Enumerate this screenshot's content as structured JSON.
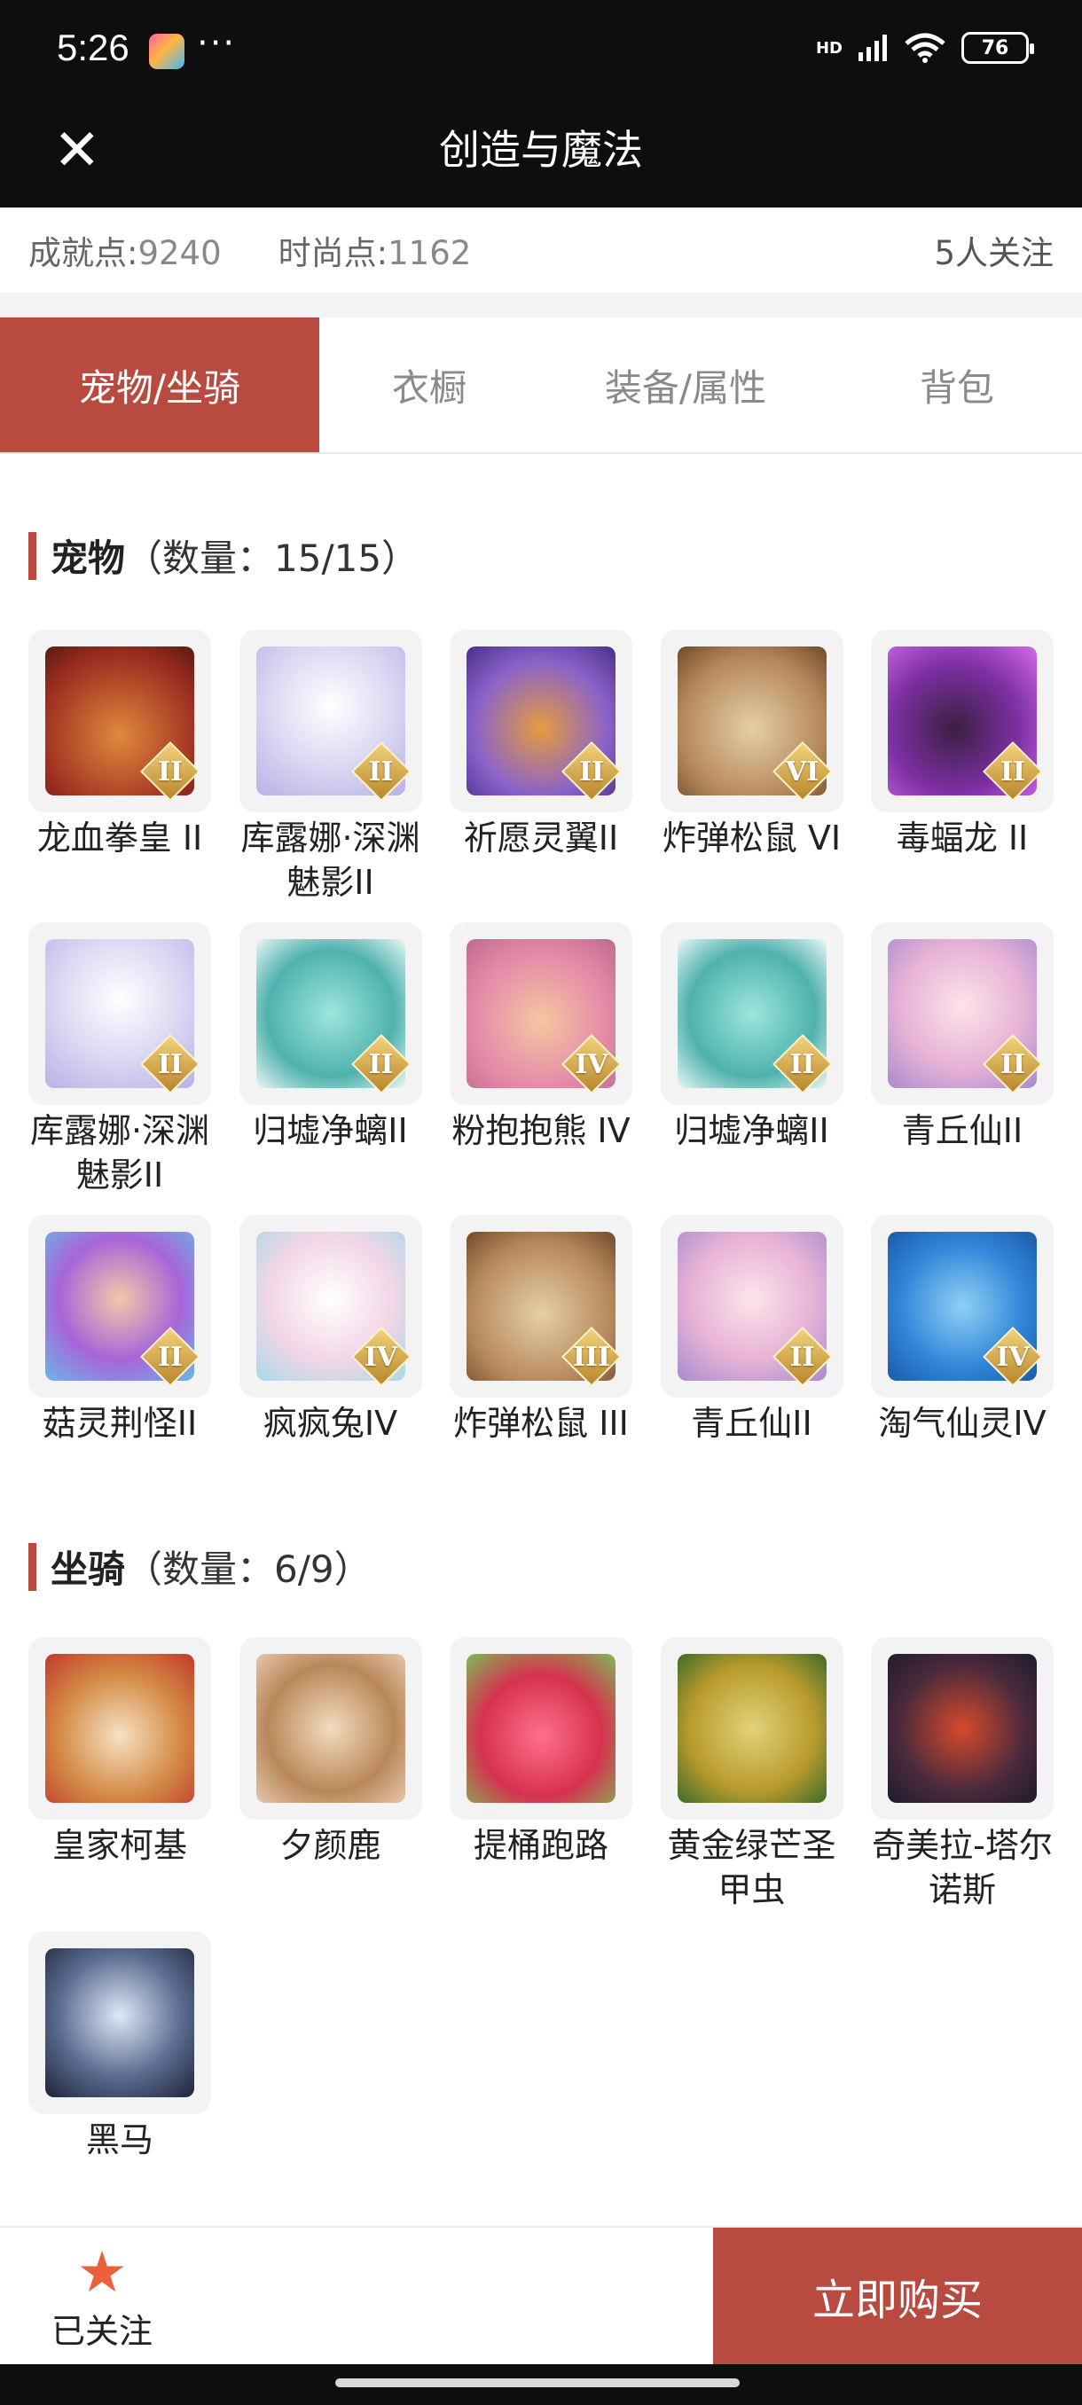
{
  "status_bar": {
    "time": "5:26",
    "network": "HD",
    "battery": "76"
  },
  "header": {
    "title": "创造与魔法",
    "close_icon": "close-icon"
  },
  "stats": {
    "achievement_label": "成就点:",
    "achievement_value": "9240",
    "fashion_label": "时尚点:",
    "fashion_value": "1162",
    "followers": "5人关注"
  },
  "tabs": [
    {
      "label": "宠物/坐骑",
      "active": true
    },
    {
      "label": "衣橱",
      "active": false
    },
    {
      "label": "装备/属性",
      "active": false
    },
    {
      "label": "背包",
      "active": false
    }
  ],
  "pets": {
    "title": "宠物",
    "count": "（数量：15/15）",
    "items": [
      {
        "name": "龙血拳皇 II",
        "badge": "II"
      },
      {
        "name": "库露娜·深渊魅影II",
        "badge": "II"
      },
      {
        "name": "祈愿灵翼II",
        "badge": "II"
      },
      {
        "name": "炸弹松鼠 VI",
        "badge": "VI"
      },
      {
        "name": "毒蝠龙 II",
        "badge": "II"
      },
      {
        "name": "库露娜·深渊魅影II",
        "badge": "II"
      },
      {
        "name": "归墟净螭II",
        "badge": "II"
      },
      {
        "name": "粉抱抱熊 IV",
        "badge": "IV"
      },
      {
        "name": "归墟净螭II",
        "badge": "II"
      },
      {
        "name": "青丘仙II",
        "badge": "II"
      },
      {
        "name": "菇灵荆怪II",
        "badge": "II"
      },
      {
        "name": "疯疯兔IV",
        "badge": "IV"
      },
      {
        "name": "炸弹松鼠 III",
        "badge": "III"
      },
      {
        "name": "青丘仙II",
        "badge": "II"
      },
      {
        "name": "淘气仙灵IV",
        "badge": "IV"
      }
    ]
  },
  "mounts": {
    "title": "坐骑",
    "count": "（数量：6/9）",
    "items": [
      {
        "name": "皇家柯基"
      },
      {
        "name": "夕颜鹿"
      },
      {
        "name": "提桶跑路"
      },
      {
        "name": "黄金绿芒圣甲虫"
      },
      {
        "name": "奇美拉-塔尔诺斯"
      },
      {
        "name": "黑马"
      }
    ]
  },
  "bottom_bar": {
    "follow_label": "已关注",
    "follow_icon": "star-icon",
    "buy_label": "立即购买"
  },
  "colors": {
    "accent": "#b84a40",
    "header_bg": "#0e0e0e",
    "star": "#e9603b"
  }
}
